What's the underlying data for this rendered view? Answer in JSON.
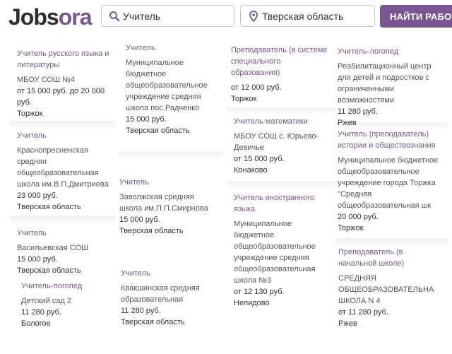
{
  "logo": {
    "part1": "Jobs",
    "part2": "ora"
  },
  "search": {
    "query": "Учитель",
    "location": "Тверская область",
    "button": "НАЙТИ РАБОТУ"
  },
  "colors": {
    "brand": "#7b5591",
    "text": "#333333"
  },
  "icons": {
    "query": "search-icon",
    "location": "location-pin-icon"
  },
  "jobs": [
    {
      "title": "Учитель русского языка и литературы",
      "org": "МБОУ СОШ №4",
      "salary": "от 15 000 руб. до 20 000 руб.",
      "city": "Торжок"
    },
    {
      "title": "Учитель",
      "org": "Краснопресненская средняя общеобразовательная школа им.В.П.Дмитриева",
      "salary": "23 000 руб.",
      "city": "Тверская область"
    },
    {
      "title": "Учитель",
      "org": "Васильевская СОШ",
      "salary": "15 000 руб.",
      "city": "Тверская область"
    },
    {
      "title": "Учитель-логопед",
      "org": "Детский сад 2",
      "salary": "11 280 руб.",
      "city": "Бологое"
    },
    {
      "title": "Учитель",
      "org": "Муниципальное бюджетное общеобразовательное учреждение средняя школа пос.Радченко",
      "salary": "15 000 руб.",
      "city": "Тверская область"
    },
    {
      "title": "Учитель",
      "org": "Заволжская средняя школа им.П.П.Смирнова",
      "salary": "15 000 руб.",
      "city": "Тверская область"
    },
    {
      "title": "Учитель",
      "org": "Квакшинская средняя образовательная",
      "salary": "11 280 руб.",
      "city": "Тверская область"
    },
    {
      "title": "Преподаватель (в системе специального образования)",
      "org": "",
      "salary": "от 12 000 руб.",
      "city": "Торжок"
    },
    {
      "title": "Учитель математики",
      "org": "МБОУ СОШ с. Юрьево-Девичье",
      "salary": "от 15 000 руб.",
      "city": "Конаково"
    },
    {
      "title": "Учитель иностранного языка",
      "org": "Муниципальное бюджетное общеобразовательное учреждение средняя общеобразовательная школа №3",
      "salary": "от 12 130 руб.",
      "city": "Нелидово"
    },
    {
      "title": "Учитель-логопед",
      "org": "Реабилитационный центр для детей и подростков с ограниченными возможностями",
      "salary": "11 280 руб.",
      "city": "Ржев"
    },
    {
      "title": "Учитель (преподаватель) истории и обществознания",
      "org": "Муниципальное бюджетное общеобразовательное учреждение города Торжка \"Средняя общеобразовательная шк",
      "salary": "20 000 руб.",
      "city": "Торжок"
    },
    {
      "title": "Преподаватель (в начальной школе)",
      "org": "СРЕДНЯЯ ОБЩЕОБРАЗОВАТЕЛЬНАЯ ШКОЛА N 4",
      "salary": "от 11 280 руб.",
      "city": "Ржев"
    }
  ]
}
